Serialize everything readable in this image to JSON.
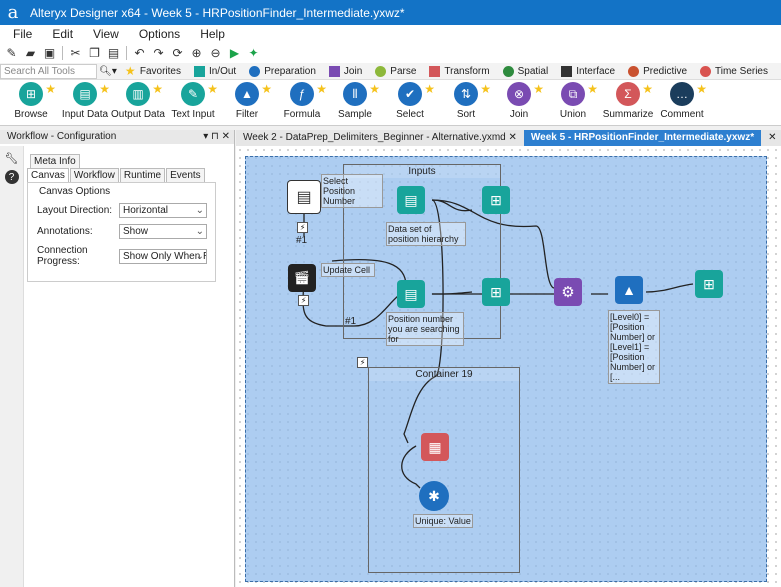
{
  "window": {
    "title": "Alteryx Designer x64 - Week 5 - HRPositionFinder_Intermediate.yxwz*",
    "logo": "a"
  },
  "menu": [
    "File",
    "Edit",
    "View",
    "Options",
    "Help"
  ],
  "search": {
    "placeholder": "Search All Tools"
  },
  "categories": [
    {
      "label": "Favorites",
      "color": "#f5c21b"
    },
    {
      "label": "In/Out",
      "color": "#18a49b"
    },
    {
      "label": "Preparation",
      "color": "#1f6fbf"
    },
    {
      "label": "Join",
      "color": "#7a4bb2"
    },
    {
      "label": "Parse",
      "color": "#8db83a"
    },
    {
      "label": "Transform",
      "color": "#d3575a"
    },
    {
      "label": "Spatial",
      "color": "#2e8b3e"
    },
    {
      "label": "Interface",
      "color": "#333333"
    },
    {
      "label": "Predictive",
      "color": "#c9512f"
    },
    {
      "label": "Time Series",
      "color": "#d9534f"
    }
  ],
  "tools": [
    {
      "label": "Browse",
      "color": "#18a49b",
      "glyph": "⊞"
    },
    {
      "label": "Input Data",
      "color": "#18a49b",
      "glyph": "▤"
    },
    {
      "label": "Output Data",
      "color": "#18a49b",
      "glyph": "▥"
    },
    {
      "label": "Text Input",
      "color": "#18a49b",
      "glyph": "✎"
    },
    {
      "label": "Filter",
      "color": "#1f6fbf",
      "glyph": "▲"
    },
    {
      "label": "Formula",
      "color": "#1f6fbf",
      "glyph": "ƒ"
    },
    {
      "label": "Sample",
      "color": "#1f6fbf",
      "glyph": "⦀"
    },
    {
      "label": "Select",
      "color": "#1f6fbf",
      "glyph": "✔"
    },
    {
      "label": "Sort",
      "color": "#1f6fbf",
      "glyph": "⇅"
    },
    {
      "label": "Join",
      "color": "#7a4bb2",
      "glyph": "⊗"
    },
    {
      "label": "Union",
      "color": "#7a4bb2",
      "glyph": "⧉"
    },
    {
      "label": "Summarize",
      "color": "#d3575a",
      "glyph": "Σ"
    },
    {
      "label": "Comment",
      "color": "#1b3d5c",
      "glyph": "…"
    }
  ],
  "left_panel": {
    "title": "Workflow - Configuration",
    "controls": "▾ ⊓ ✕",
    "meta_tab": "Meta Info",
    "tabs": [
      "Canvas",
      "Workflow",
      "Runtime",
      "Events"
    ],
    "group_title": "Canvas Options",
    "options": [
      {
        "label": "Layout Direction:",
        "value": "Horizontal"
      },
      {
        "label": "Annotations:",
        "value": "Show"
      },
      {
        "label": "Connection Progress:",
        "value": "Show Only When R"
      }
    ]
  },
  "doc_tabs": [
    {
      "label": "Week 2 - DataPrep_Delimiters_Beginner - Alternative.yxmd",
      "active": false
    },
    {
      "label": "Week 5 - HRPositionFinder_Intermediate.yxwz*",
      "active": true
    }
  ],
  "canvas": {
    "container_inputs": "Inputs",
    "container_19": "Container 19",
    "anno_select": "Select Position Number",
    "anno_update": "Update Cell",
    "anno_dataset": "Data set of position hierarchy",
    "anno_posnum": "Position number you are searching for",
    "anno_filter": "[Level0] = [Position Number] or [Level1] = [Position Number] or [...",
    "anno_unique": "Unique: Value",
    "hash1": "#1",
    "hash2": "#1"
  }
}
